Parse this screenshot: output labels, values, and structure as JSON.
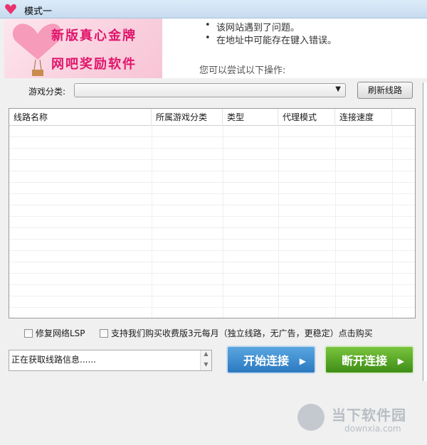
{
  "window": {
    "title": "模式一"
  },
  "banner": {
    "line1": "新版真心金牌",
    "line2": "网吧奖励软件"
  },
  "error_page": {
    "items": [
      "该网站遇到了问题。",
      "在地址中可能存在键入错误。"
    ],
    "try_text": "您可以尝试以下操作:"
  },
  "toolbar": {
    "category_label": "游戏分类:",
    "category_value": "",
    "refresh_label": "刷新线路"
  },
  "table": {
    "columns": [
      "线路名称",
      "所属游戏分类",
      "类型",
      "代理模式",
      "连接速度"
    ],
    "rows": []
  },
  "options": {
    "fix_lsp_label": "修复网络LSP",
    "fix_lsp_checked": false,
    "buy_label": "支持我们购买收费版3元每月（独立线路，无广告，更稳定）点击购买",
    "buy_checked": false
  },
  "status": {
    "text": "正在获取线路信息......"
  },
  "actions": {
    "connect_label": "开始连接",
    "disconnect_label": "断开连接"
  },
  "watermark": {
    "title": "当下软件园",
    "subtitle": "downxia.com"
  },
  "colors": {
    "connect": "#2b79c0",
    "disconnect": "#3e8d16",
    "brand_pink": "#e0156b"
  }
}
